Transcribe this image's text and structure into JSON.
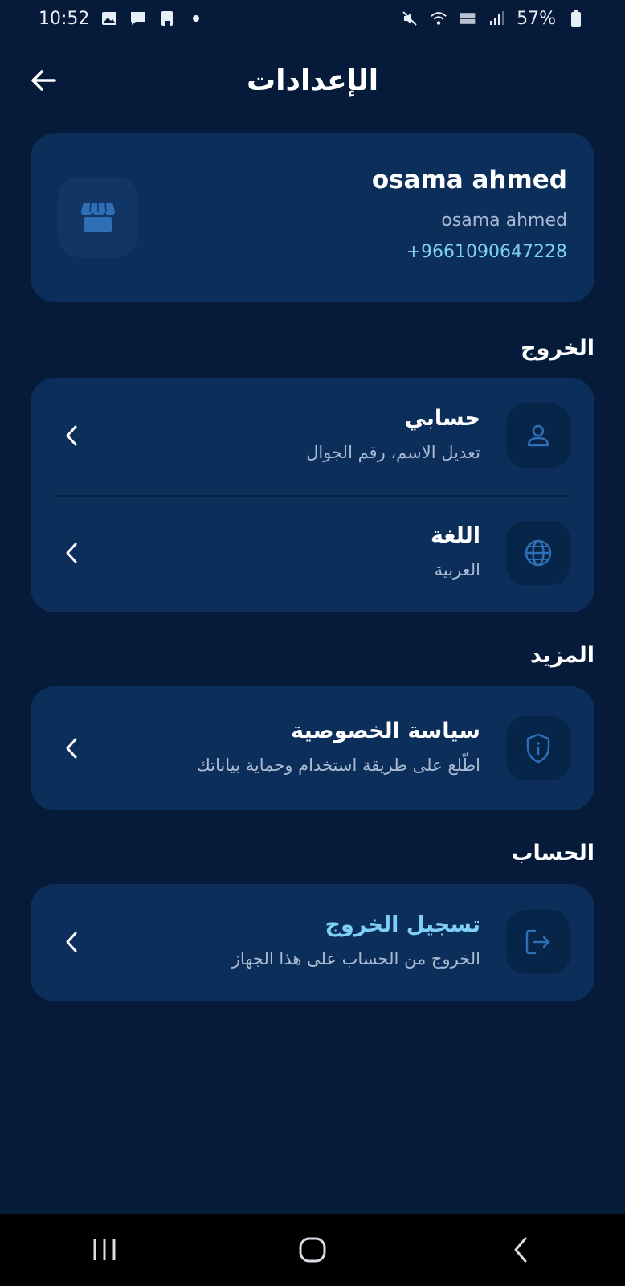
{
  "status_bar": {
    "time": "10:52",
    "battery": "57%"
  },
  "header": {
    "title": "الإعدادات"
  },
  "profile": {
    "name": "osama ahmed",
    "username": "osama ahmed",
    "phone": "+9661090647228"
  },
  "sections": {
    "logout_section_title": "الخروج",
    "more_section_title": "المزيد",
    "account_section_title": "الحساب"
  },
  "items": {
    "account": {
      "title": "حسابي",
      "subtitle": "تعديل الاسم، رقم الجوال"
    },
    "language": {
      "title": "اللغة",
      "subtitle": "العربية"
    },
    "privacy": {
      "title": "سياسة الخصوصية",
      "subtitle": "اطّلع على طريقة استخدام وحماية بياناتك"
    },
    "logout": {
      "title": "تسجيل الخروج",
      "subtitle": "الخروج من الحساب على هذا الجهاز"
    }
  },
  "colors": {
    "background": "#061b3a",
    "card": "#0b2e5a",
    "icon_tile": "#072449",
    "accent": "#7fd0f7",
    "icon": "#2e6fb5"
  }
}
